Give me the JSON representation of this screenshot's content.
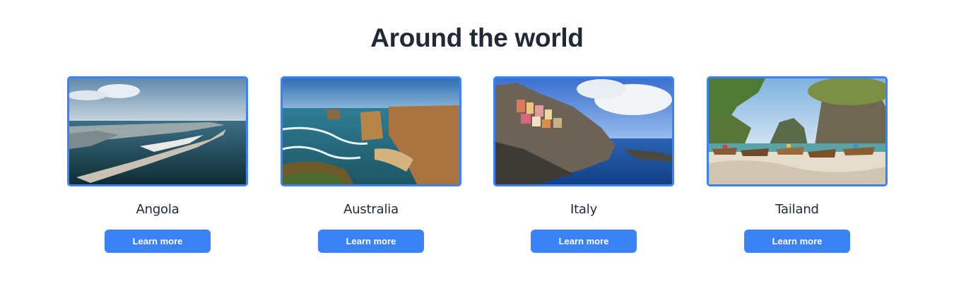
{
  "section": {
    "title": "Around the world"
  },
  "colors": {
    "accent": "#3b82f6",
    "heading": "#1f2937"
  },
  "destinations": [
    {
      "name": "Angola",
      "button_label": "Learn more",
      "image": "coastal-city-peninsula-photo"
    },
    {
      "name": "Australia",
      "button_label": "Learn more",
      "image": "sea-stack-cliffs-photo"
    },
    {
      "name": "Italy",
      "button_label": "Learn more",
      "image": "cliffside-village-photo"
    },
    {
      "name": "Tailand",
      "button_label": "Learn more",
      "image": "beach-longtail-boats-photo"
    }
  ]
}
